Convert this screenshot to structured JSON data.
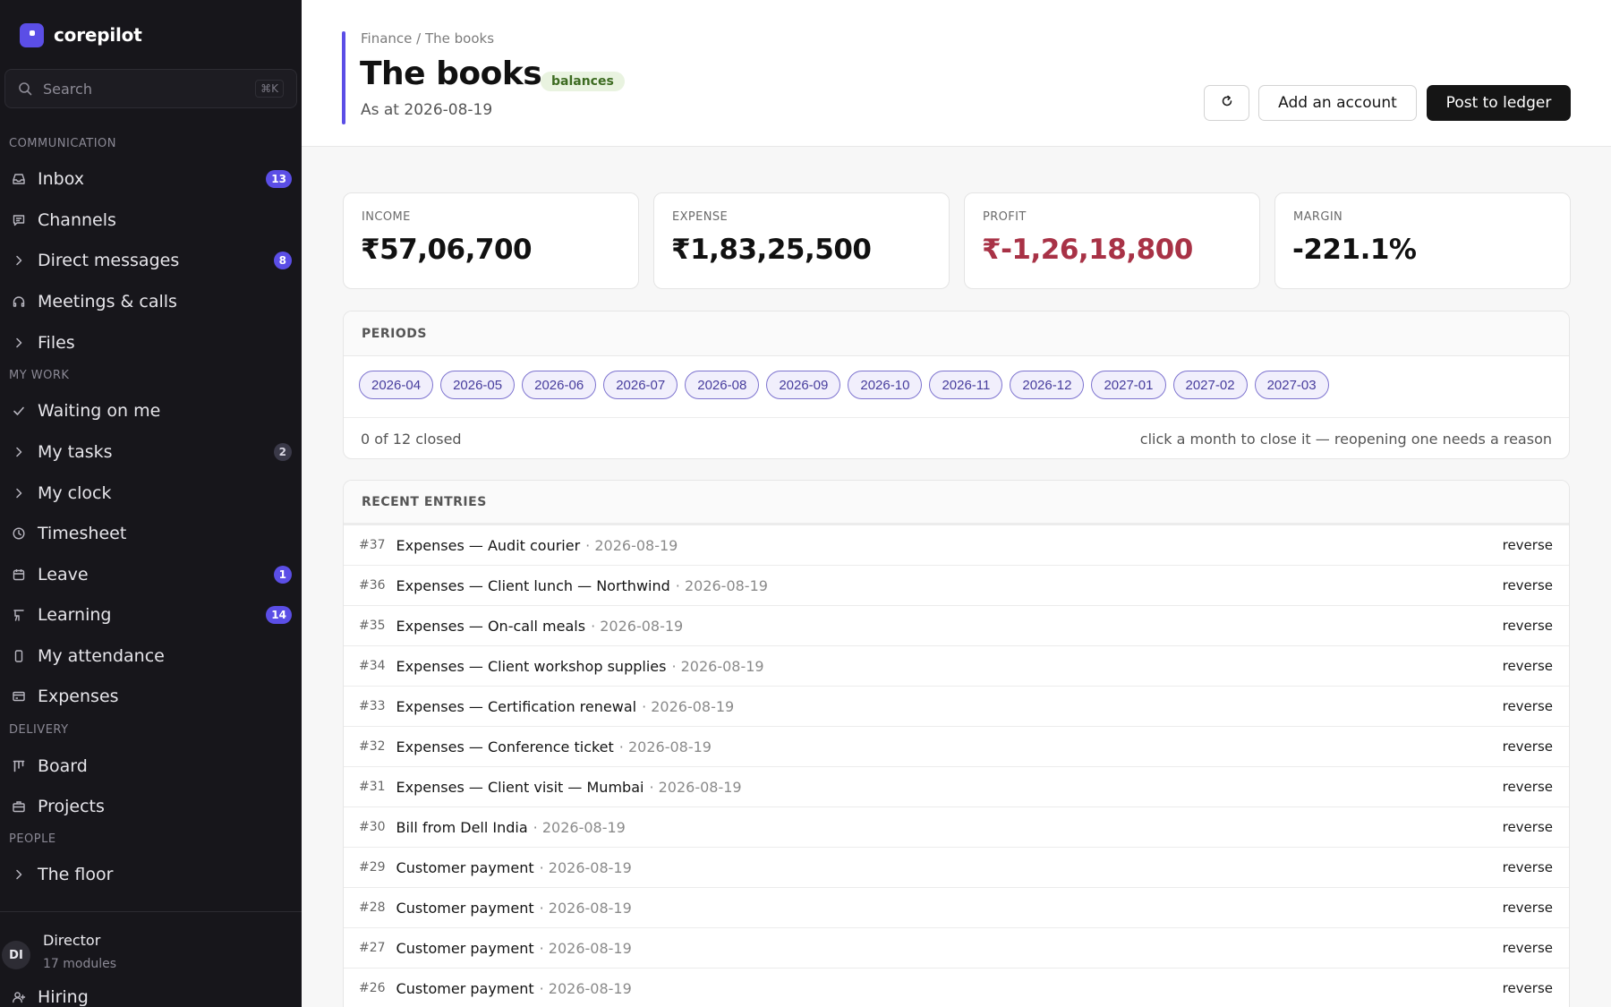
{
  "app": {
    "name": "corepilot"
  },
  "search": {
    "placeholder": "Search",
    "shortcut": "⌘K"
  },
  "sidebar": {
    "sections": {
      "communication": "COMMUNICATION",
      "my_work": "MY WORK",
      "delivery": "DELIVERY",
      "people": "PEOPLE"
    },
    "items": [
      {
        "label": "Inbox",
        "icon": "inbox-icon",
        "badge": "13"
      },
      {
        "label": "Channels",
        "icon": "chat-icon",
        "badge": ""
      },
      {
        "label": "Direct messages",
        "icon": "chevron-right-icon",
        "badge": "8"
      },
      {
        "label": "Meetings & calls",
        "icon": "headphones-icon",
        "badge": ""
      },
      {
        "label": "Files",
        "icon": "chevron-right-icon",
        "badge": ""
      },
      {
        "label": "Waiting on me",
        "icon": "check-icon",
        "badge": ""
      },
      {
        "label": "My tasks",
        "icon": "chevron-right-icon",
        "badge": "2"
      },
      {
        "label": "My clock",
        "icon": "chevron-right-icon",
        "badge": ""
      },
      {
        "label": "Timesheet",
        "icon": "clock-icon",
        "badge": ""
      },
      {
        "label": "Leave",
        "icon": "calendar-icon",
        "badge": "1"
      },
      {
        "label": "Learning",
        "icon": "easel-icon",
        "badge": "14"
      },
      {
        "label": "My attendance",
        "icon": "phone-icon",
        "badge": ""
      },
      {
        "label": "Expenses",
        "icon": "card-icon",
        "badge": ""
      },
      {
        "label": "Board",
        "icon": "kanban-icon",
        "badge": ""
      },
      {
        "label": "Projects",
        "icon": "briefcase-icon",
        "badge": ""
      },
      {
        "label": "The floor",
        "icon": "chevron-right-icon",
        "badge": ""
      },
      {
        "label": "Hiring",
        "icon": "user-plus-icon",
        "badge": ""
      }
    ],
    "user": {
      "initials": "DI",
      "name": "Director",
      "subtitle": "17 modules"
    }
  },
  "header": {
    "breadcrumb": "Finance / The books",
    "title": "The books",
    "badge": "balances",
    "subtitle": "As at 2026-08-19",
    "add_label": "Add an account",
    "post_label": "Post to ledger"
  },
  "kpis": [
    {
      "label": "INCOME",
      "value": "₹57,06,700"
    },
    {
      "label": "EXPENSE",
      "value": "₹1,83,25,500"
    },
    {
      "label": "PROFIT",
      "value": "₹-1,26,18,800"
    },
    {
      "label": "MARGIN",
      "value": "-221.1%"
    }
  ],
  "periods": {
    "title": "PERIODS",
    "months": [
      "2026-04",
      "2026-05",
      "2026-06",
      "2026-07",
      "2026-08",
      "2026-09",
      "2026-10",
      "2026-11",
      "2026-12",
      "2027-01",
      "2027-02",
      "2027-03"
    ],
    "closed_text": "0 of 12 closed",
    "hint": "click a month to close it — reopening one needs a reason"
  },
  "entries": {
    "title": "RECENT ENTRIES",
    "action_label": "reverse",
    "rows": [
      {
        "id": "#37",
        "desc": "Expenses — Audit courier",
        "date": "· 2026-08-19"
      },
      {
        "id": "#36",
        "desc": "Expenses — Client lunch — Northwind",
        "date": "· 2026-08-19"
      },
      {
        "id": "#35",
        "desc": "Expenses — On-call meals",
        "date": "· 2026-08-19"
      },
      {
        "id": "#34",
        "desc": "Expenses — Client workshop supplies",
        "date": "· 2026-08-19"
      },
      {
        "id": "#33",
        "desc": "Expenses — Certification renewal",
        "date": "· 2026-08-19"
      },
      {
        "id": "#32",
        "desc": "Expenses — Conference ticket",
        "date": "· 2026-08-19"
      },
      {
        "id": "#31",
        "desc": "Expenses — Client visit — Mumbai",
        "date": "· 2026-08-19"
      },
      {
        "id": "#30",
        "desc": "Bill from Dell India",
        "date": "· 2026-08-19"
      },
      {
        "id": "#29",
        "desc": "Customer payment",
        "date": "· 2026-08-19"
      },
      {
        "id": "#28",
        "desc": "Customer payment",
        "date": "· 2026-08-19"
      },
      {
        "id": "#27",
        "desc": "Customer payment",
        "date": "· 2026-08-19"
      },
      {
        "id": "#26",
        "desc": "Customer payment",
        "date": "· 2026-08-19"
      }
    ]
  },
  "colors": {
    "accent": "#5b4ee6",
    "negative": "#a83246",
    "sidebar_bg": "#17161b"
  }
}
